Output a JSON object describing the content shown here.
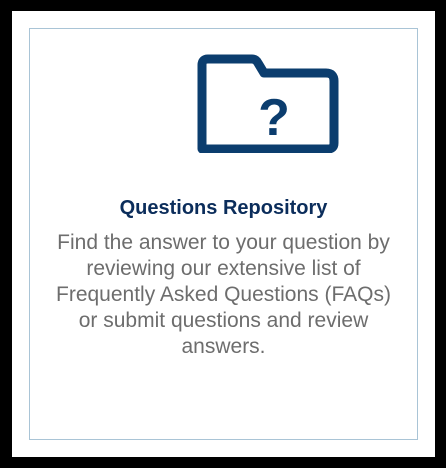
{
  "card": {
    "icon": "folder-question-icon",
    "icon_glyph": "?",
    "title": "Questions Repository",
    "description": "Find the answer to your question by reviewing our extensive list of Frequently Asked Questions (FAQs) or submit questions and review answers."
  },
  "colors": {
    "title": "#0b2d5b",
    "icon": "#0b3d6e",
    "description": "#6d6d6d",
    "card_border": "#a9c4d6",
    "frame": "#000000"
  }
}
